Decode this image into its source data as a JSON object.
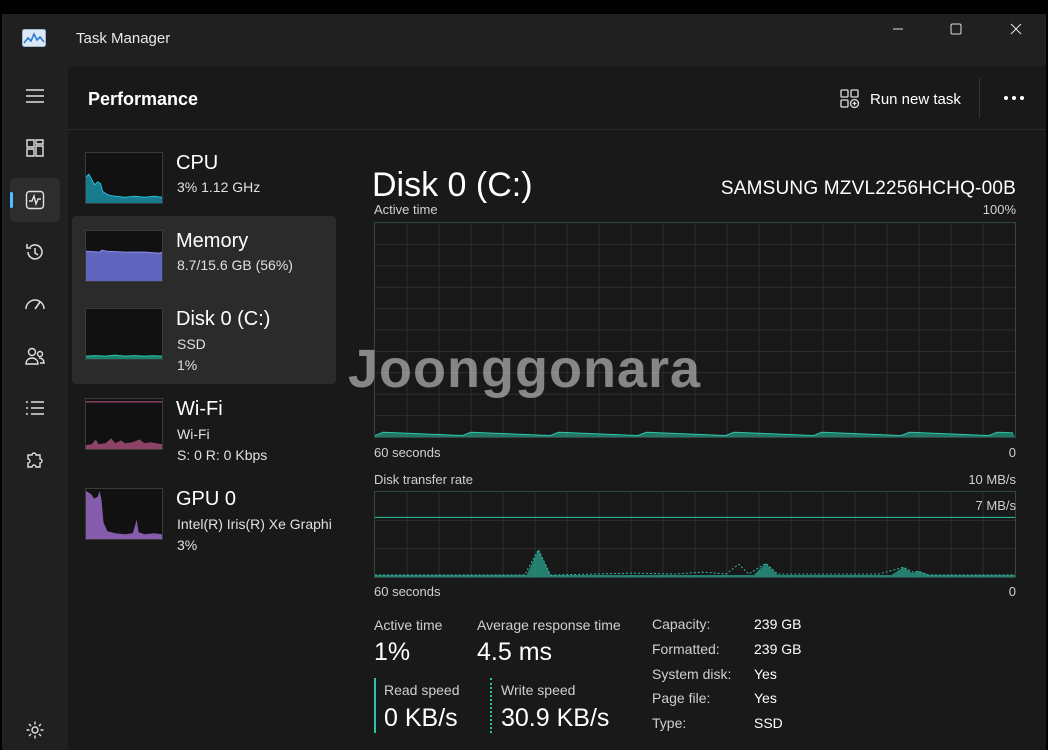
{
  "window": {
    "title": "Task Manager"
  },
  "header": {
    "title": "Performance",
    "run_task": "Run new task"
  },
  "sidebar": [
    {
      "name": "CPU",
      "sub1": "3%  1.12 GHz",
      "sub2": "",
      "color": "#17a2b8",
      "selected": false
    },
    {
      "name": "Memory",
      "sub1": "8.7/15.6 GB (56%)",
      "sub2": "",
      "color": "#7b7fd6",
      "selected": false
    },
    {
      "name": "Disk 0 (C:)",
      "sub1": "SSD",
      "sub2": "1%",
      "color": "#2ec4a8",
      "selected": true
    },
    {
      "name": "Wi-Fi",
      "sub1": "Wi-Fi",
      "sub2": "S: 0  R: 0 Kbps",
      "color": "#d46ba0",
      "selected": false
    },
    {
      "name": "GPU 0",
      "sub1": "Intel(R) Iris(R) Xe Graphi",
      "sub2": "3%",
      "color": "#a774d6",
      "selected": false
    }
  ],
  "detail": {
    "title": "Disk 0 (C:)",
    "model": "SAMSUNG MZVL2256HCHQ-00B",
    "active_graph": {
      "label": "Active time",
      "max": "100%",
      "left": "60 seconds",
      "right": "0"
    },
    "transfer_graph": {
      "label": "Disk transfer rate",
      "max": "10 MB/s",
      "marker": "7 MB/s",
      "left": "60 seconds",
      "right": "0"
    },
    "stats": {
      "active_time_label": "Active time",
      "active_time": "1%",
      "avg_resp_label": "Average response time",
      "avg_resp": "4.5 ms",
      "read_label": "Read speed",
      "read": "0 KB/s",
      "write_label": "Write speed",
      "write": "30.9 KB/s"
    },
    "props": [
      {
        "k": "Capacity:",
        "v": "239 GB"
      },
      {
        "k": "Formatted:",
        "v": "239 GB"
      },
      {
        "k": "System disk:",
        "v": "Yes"
      },
      {
        "k": "Page file:",
        "v": "Yes"
      },
      {
        "k": "Type:",
        "v": "SSD"
      }
    ]
  },
  "watermark": "Joonggonara",
  "accent": "#4cc2ff",
  "disk_color": "#2ec4a8"
}
